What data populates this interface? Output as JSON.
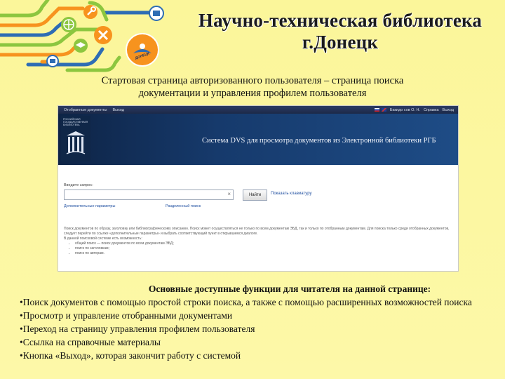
{
  "slide": {
    "title_line1": "Научно-техническая библиотека",
    "title_line2": "г.Донецк",
    "subtitle_line1": "Стартовая страница авторизованного пользователя – страница поиска",
    "subtitle_line2": "документации и управления профилем пользователя",
    "logo_text": "ДОНЕЦК",
    "colors": {
      "background": "#fbf69c",
      "deco_green": "#8cc63f",
      "deco_orange": "#f7931e",
      "deco_blue": "#2e6db4"
    }
  },
  "screenshot": {
    "nav": {
      "item1": "Отобранные документы",
      "item2": "Выход"
    },
    "topright": {
      "user": "Бакидо сов О. Н.",
      "help": "Справка",
      "exit": "Выход"
    },
    "logo_text": "РОССИЙСКАЯ ГОСУДАРСТВЕННАЯ БИБЛИОТЕКА",
    "banner_title": "Система DVS для просмотра документов из Электронной библиотеки РГБ",
    "search": {
      "label": "Введите запрос:",
      "value": "",
      "clear_icon": "×",
      "button": "Найти",
      "keyboard_link": "Показать клавиатуру"
    },
    "links": {
      "advanced": "Дополнительные параметры",
      "sections": "Разделенный поиск"
    },
    "description": "Поиск документов по образу, заголовку или библиографическому описанию. Поиск может осуществляться не только по всем документам ЭБД, так и только по отобранным документам. Для поиска только среди отобранных документов, следует перейти по ссылке «дополнительные параметры» и выбрать соответствующий пункт в открывшемся диалоге.",
    "description_sub": "В данной поисковой системе есть возможность:",
    "description_items": [
      "общий поиск — поиск документов по всем документам ЭБД;",
      "поиск по заголовкам;",
      "поиск по авторам."
    ]
  },
  "functions": {
    "heading": "Основные доступные функции для читателя на данной странице:",
    "items": [
      "•Поиск документов с помощью простой строки поиска, а также с помощью расширенных возможностей поиска",
      "•Просмотр и управление отобранными документами",
      "•Переход на страницу управления профилем пользователя",
      "•Ссылка на справочные материалы",
      "•Кнопка «Выход», которая закончит работу с системой"
    ]
  }
}
